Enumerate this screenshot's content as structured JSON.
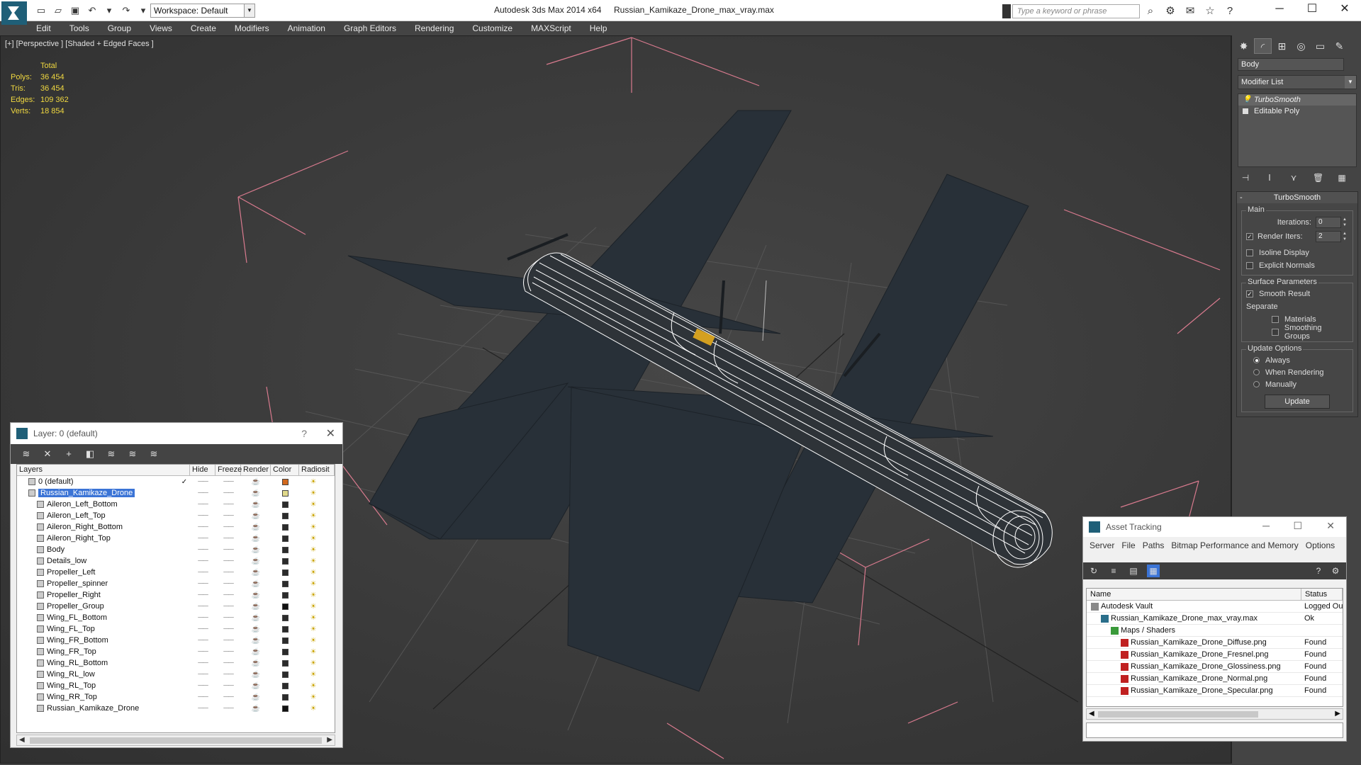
{
  "title": {
    "app": "Autodesk 3ds Max  2014 x64",
    "file": "Russian_Kamikaze_Drone_max_vray.max",
    "workspace": "Workspace: Default",
    "search_placeholder": "Type a keyword or phrase"
  },
  "menu": [
    "Edit",
    "Tools",
    "Group",
    "Views",
    "Create",
    "Modifiers",
    "Animation",
    "Graph Editors",
    "Rendering",
    "Customize",
    "MAXScript",
    "Help"
  ],
  "viewport": {
    "label": "[+] [Perspective ] [Shaded + Edged Faces ]",
    "stats": {
      "header": "Total",
      "rows": [
        {
          "k": "Polys:",
          "v": "36 454"
        },
        {
          "k": "Tris:",
          "v": "36 454"
        },
        {
          "k": "Edges:",
          "v": "109 362"
        },
        {
          "k": "Verts:",
          "v": "18 854"
        }
      ]
    }
  },
  "layer_panel": {
    "title": "Layer: 0 (default)",
    "help": "?",
    "columns": [
      "Layers",
      "Hide",
      "Freeze",
      "Render",
      "Color",
      "Radiosit"
    ],
    "rows": [
      {
        "name": "0 (default)",
        "level": 0,
        "check": "✓",
        "color": "#d2691e"
      },
      {
        "name": "Russian_Kamikaze_Drone",
        "level": 0,
        "selected": true,
        "color": "#e0d98a"
      },
      {
        "name": "Aileron_Left_Bottom",
        "level": 1,
        "color": "#2b2b2b"
      },
      {
        "name": "Aileron_Left_Top",
        "level": 1,
        "color": "#2b2b2b"
      },
      {
        "name": "Aileron_Right_Bottom",
        "level": 1,
        "color": "#2b2b2b"
      },
      {
        "name": "Aileron_Right_Top",
        "level": 1,
        "color": "#2b2b2b"
      },
      {
        "name": "Body",
        "level": 1,
        "color": "#2b2b2b"
      },
      {
        "name": "Details_low",
        "level": 1,
        "color": "#2b2b2b"
      },
      {
        "name": "Propeller_Left",
        "level": 1,
        "color": "#2b2b2b"
      },
      {
        "name": "Propeller_spinner",
        "level": 1,
        "color": "#2b2b2b"
      },
      {
        "name": "Propeller_Right",
        "level": 1,
        "color": "#2b2b2b"
      },
      {
        "name": "Propeller_Group",
        "level": 1,
        "color": "#111111"
      },
      {
        "name": "Wing_FL_Bottom",
        "level": 1,
        "color": "#2b2b2b"
      },
      {
        "name": "Wing_FL_Top",
        "level": 1,
        "color": "#2b2b2b"
      },
      {
        "name": "Wing_FR_Bottom",
        "level": 1,
        "color": "#2b2b2b"
      },
      {
        "name": "Wing_FR_Top",
        "level": 1,
        "color": "#2b2b2b"
      },
      {
        "name": "Wing_RL_Bottom",
        "level": 1,
        "color": "#2b2b2b"
      },
      {
        "name": "Wing_RL_low",
        "level": 1,
        "color": "#2b2b2b"
      },
      {
        "name": "Wing_RL_Top",
        "level": 1,
        "color": "#2b2b2b"
      },
      {
        "name": "Wing_RR_Top",
        "level": 1,
        "color": "#2b2b2b"
      },
      {
        "name": "Russian_Kamikaze_Drone",
        "level": 1,
        "color": "#111111"
      }
    ]
  },
  "command_panel": {
    "object_name": "Body",
    "modifier_list": "Modifier List",
    "stack": [
      "TurboSmooth",
      "Editable Poly"
    ],
    "turbosmooth": {
      "title": "TurboSmooth",
      "main_label": "Main",
      "iterations_label": "Iterations:",
      "iterations_value": "0",
      "render_iters_label": "Render Iters:",
      "render_iters_value": "2",
      "isoline_label": "Isoline Display",
      "explicit_label": "Explicit Normals",
      "surface_label": "Surface Parameters",
      "smooth_result_label": "Smooth Result",
      "separate_label": "Separate",
      "materials_label": "Materials",
      "smoothing_groups_label": "Smoothing Groups",
      "update_options_label": "Update Options",
      "always_label": "Always",
      "when_rendering_label": "When Rendering",
      "manually_label": "Manually",
      "update_button": "Update"
    }
  },
  "asset_tracking": {
    "title": "Asset Tracking",
    "menu": [
      "Server",
      "File",
      "Paths",
      "Bitmap Performance and Memory",
      "Options"
    ],
    "columns": [
      "Name",
      "Status"
    ],
    "rows": [
      {
        "name": "Autodesk Vault",
        "status": "Logged Ou",
        "level": 0,
        "icon": "vault-icon"
      },
      {
        "name": "Russian_Kamikaze_Drone_max_vray.max",
        "status": "Ok",
        "level": 1,
        "icon": "max-file-icon"
      },
      {
        "name": "Maps / Shaders",
        "status": "",
        "level": 2,
        "icon": "maps-icon"
      },
      {
        "name": "Russian_Kamikaze_Drone_Diffuse.png",
        "status": "Found",
        "level": 3,
        "icon": "png-icon"
      },
      {
        "name": "Russian_Kamikaze_Drone_Fresnel.png",
        "status": "Found",
        "level": 3,
        "icon": "png-icon"
      },
      {
        "name": "Russian_Kamikaze_Drone_Glossiness.png",
        "status": "Found",
        "level": 3,
        "icon": "png-icon"
      },
      {
        "name": "Russian_Kamikaze_Drone_Normal.png",
        "status": "Found",
        "level": 3,
        "icon": "png-icon"
      },
      {
        "name": "Russian_Kamikaze_Drone_Specular.png",
        "status": "Found",
        "level": 3,
        "icon": "png-icon"
      }
    ]
  }
}
